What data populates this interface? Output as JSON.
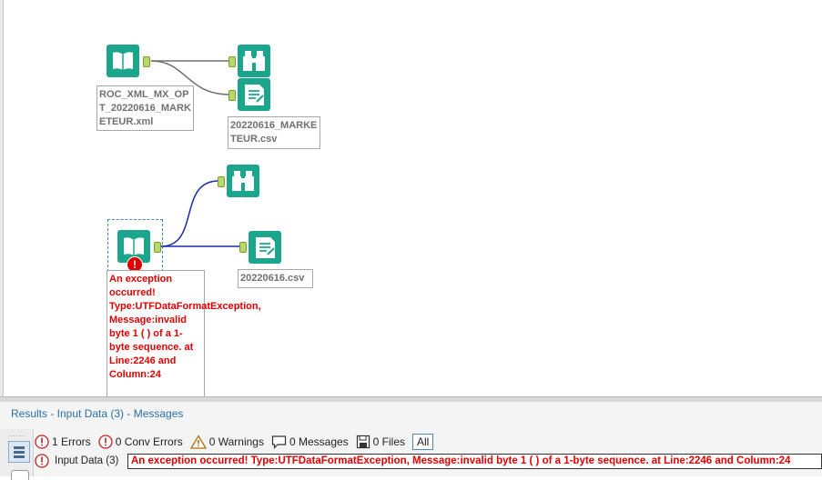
{
  "canvas": {
    "input1_label": "ROC_XML_MX_OPT_20220616_MARKETEUR.xml",
    "output1_label": "20220616_MARKETEUR.csv",
    "input2_error": "An exception occurred! Type:UTFDataFormatException, Message:invalid byte 1 ( ) of a 1-byte sequence. at Line:2246 and Column:24",
    "output2_label": "20220616.csv",
    "error_badge": "!",
    "icons": {
      "input": "book-icon",
      "browse": "binoculars-icon",
      "output": "output-file-icon"
    },
    "colors": {
      "tool": "#1aa58c",
      "anchor": "#b8d86a",
      "wire1": "#707070",
      "wire2": "#1a2aa8",
      "error": "#e00000"
    }
  },
  "results": {
    "title": "Results - Input Data (3) - Messages",
    "filters": {
      "errors": "1 Errors",
      "conv_errors": "0 Conv Errors",
      "warnings": "0 Warnings",
      "messages": "0 Messages",
      "files": "0 Files",
      "all": "All"
    },
    "message": {
      "source": "Input Data (3)",
      "text": "An exception occurred! Type:UTFDataFormatException, Message:invalid byte 1 ( ) of a 1-byte sequence. at Line:2246 and Column:24"
    }
  }
}
